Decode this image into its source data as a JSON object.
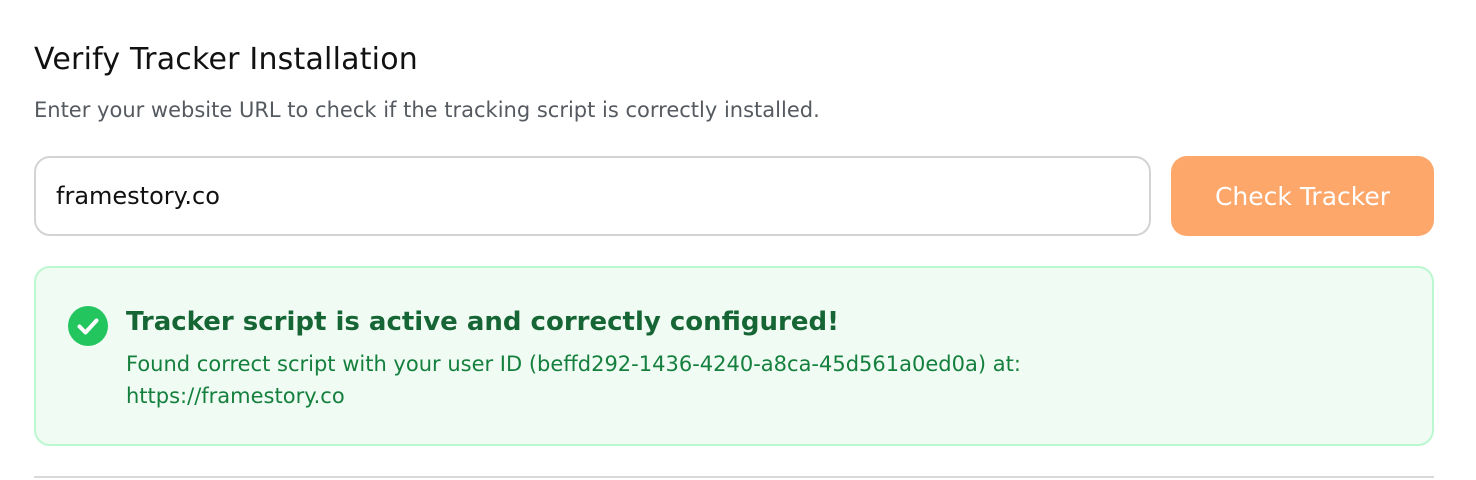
{
  "header": {
    "title": "Verify Tracker Installation",
    "subtitle": "Enter your website URL to check if the tracking script is correctly installed."
  },
  "form": {
    "url_value": "framestory.co",
    "button_label": "Check Tracker"
  },
  "result": {
    "status": "success",
    "icon": "check-circle-icon",
    "title": "Tracker script is active and correctly configured!",
    "detail": "Found correct script with your user ID (beffd292-1436-4240-a8ca-45d561a0ed0a) at: https://framestory.co"
  },
  "colors": {
    "accent_button": "#fda76b",
    "success_icon": "#22c55e",
    "success_title": "#166534",
    "success_text": "#15803d",
    "success_bg": "#f0fbf4",
    "success_border": "#bbf7d0"
  }
}
